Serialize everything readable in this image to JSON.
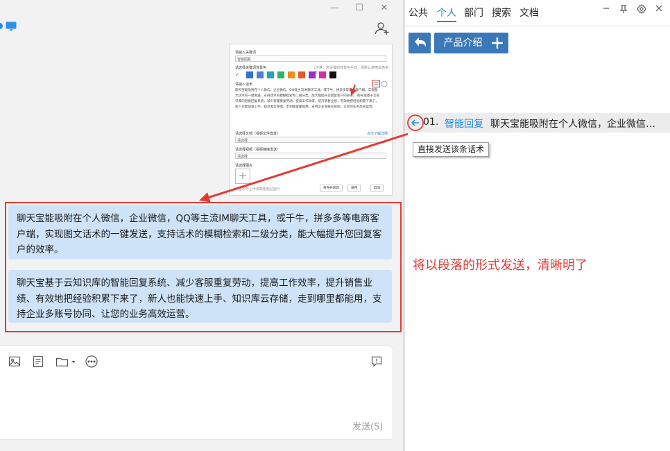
{
  "window": {
    "minimize": "—",
    "maximize": "☐",
    "close": "✕"
  },
  "embedded_screenshot": {
    "keyword_label": "请输入关键词",
    "keyword_value": "智能回复",
    "color_label": "请选择关键词背景色",
    "color_hint": "(注意：若设置的背景色手动，则默认使用白色字体)",
    "swatches": [
      "#2e74c9",
      "#4a7fdc",
      "#23a3c0",
      "#2fb36b",
      "#ef8c1f",
      "#e8542c",
      "#9b2cc9",
      "#d42ea1",
      "#111111"
    ],
    "script_label": "请输入话术",
    "script_text": "聊天宝能吸附在个人微信、企业微信、QQ等主流IM聊天工具，或千牛，拼多多等电商客户端，实现图文话术的一键发送，支持话术的模糊检索和二级分类，能大幅提升您回复客户的效率。 聊天宝基于云知识库的智能回复系统，减少客服重复劳动，提高工作效率，提升销售业绩，有效地把经验积累下来了，新人也能快速上手，知识库云存储，走到哪里都能用，支持企业多账号协同，让您的业务高效运营。",
    "file_label": "请选择文档（视频文件直发）",
    "file_link": "点击了解详情",
    "file_value": "请选择",
    "video_label": "请选择视频（视频链接发送）",
    "video_value": "请选择",
    "image_label": "请选择图片",
    "image_hint": "点击加号上传或截图粘贴图片",
    "btn_new": "保存并新建",
    "btn_save": "保存",
    "btn_cancel": "取消"
  },
  "messages": [
    {
      "text": "聊天宝能吸附在个人微信，企业微信，QQ等主流IM聊天工具，或千牛，拼多多等电商客户端，实现图文话术的一键发送，支持话术的模糊检索和二级分类，能大幅提升您回复客户的效率。"
    },
    {
      "text": "聊天宝基于云知识库的智能回复系统、减少客服重复劳动，提高工作效率，提升销售业绩、有效地把经验积累下来了，新人也能快速上手、知识库云存储，走到哪里都能用，支持企业多账号协同、让您的业务高效运营。"
    }
  ],
  "composer": {
    "send_label": "发送(S)"
  },
  "right_panel": {
    "tabs": [
      "公共",
      "个人",
      "部门",
      "搜索",
      "文档"
    ],
    "active_tab": "个人",
    "category_label": "产品介绍",
    "script_item": {
      "index": "01.",
      "title": "智能回复",
      "text": "聊天宝能吸附在个人微信，企业微信，..."
    },
    "tooltip": "直接发送该条话术",
    "annotation": "将以段落的形式发送，清晰明了"
  },
  "colors": {
    "accent": "#1e88e5",
    "button_blue": "#3a78b7",
    "bubble_bg": "#cfe3f8",
    "annotation_red": "#e23a32"
  }
}
